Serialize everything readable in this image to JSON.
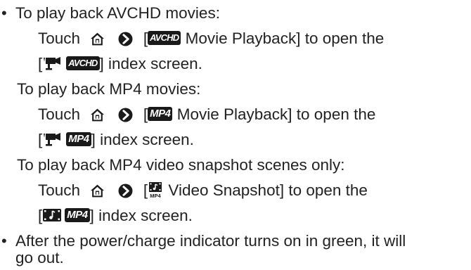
{
  "bullet_char": "•",
  "item1": {
    "heading": "To play back AVCHD movies:",
    "avchd": {
      "touch": "Touch",
      "open_bracket": "[",
      "badge": "AVCHD",
      "label_rest": " Movie Playback] to open the",
      "index_open": "[",
      "index_badge": "AVCHD",
      "index_rest": "] index screen."
    },
    "mp4_heading": "To play back MP4 movies:",
    "mp4": {
      "touch": "Touch",
      "open_bracket": "[",
      "badge": "MP4",
      "label_rest": " Movie Playback] to open the",
      "index_open": "[",
      "index_badge": "MP4",
      "index_rest": "] index screen."
    },
    "snap_heading": "To play back MP4 video snapshot scenes only:",
    "snap": {
      "touch": "Touch",
      "open_bracket": "[",
      "icon_sub": "MP4",
      "label_rest": " Video Snapshot] to open the",
      "index_open": "[",
      "index_badge": "MP4",
      "index_rest": "] index screen."
    }
  },
  "item2": {
    "line1": "After the power/charge indicator turns on in green, it will",
    "line2": "go out."
  },
  "icons": [
    "home-icon",
    "arrow-right-icon",
    "movie-camera-icon",
    "video-snapshot-icon"
  ]
}
